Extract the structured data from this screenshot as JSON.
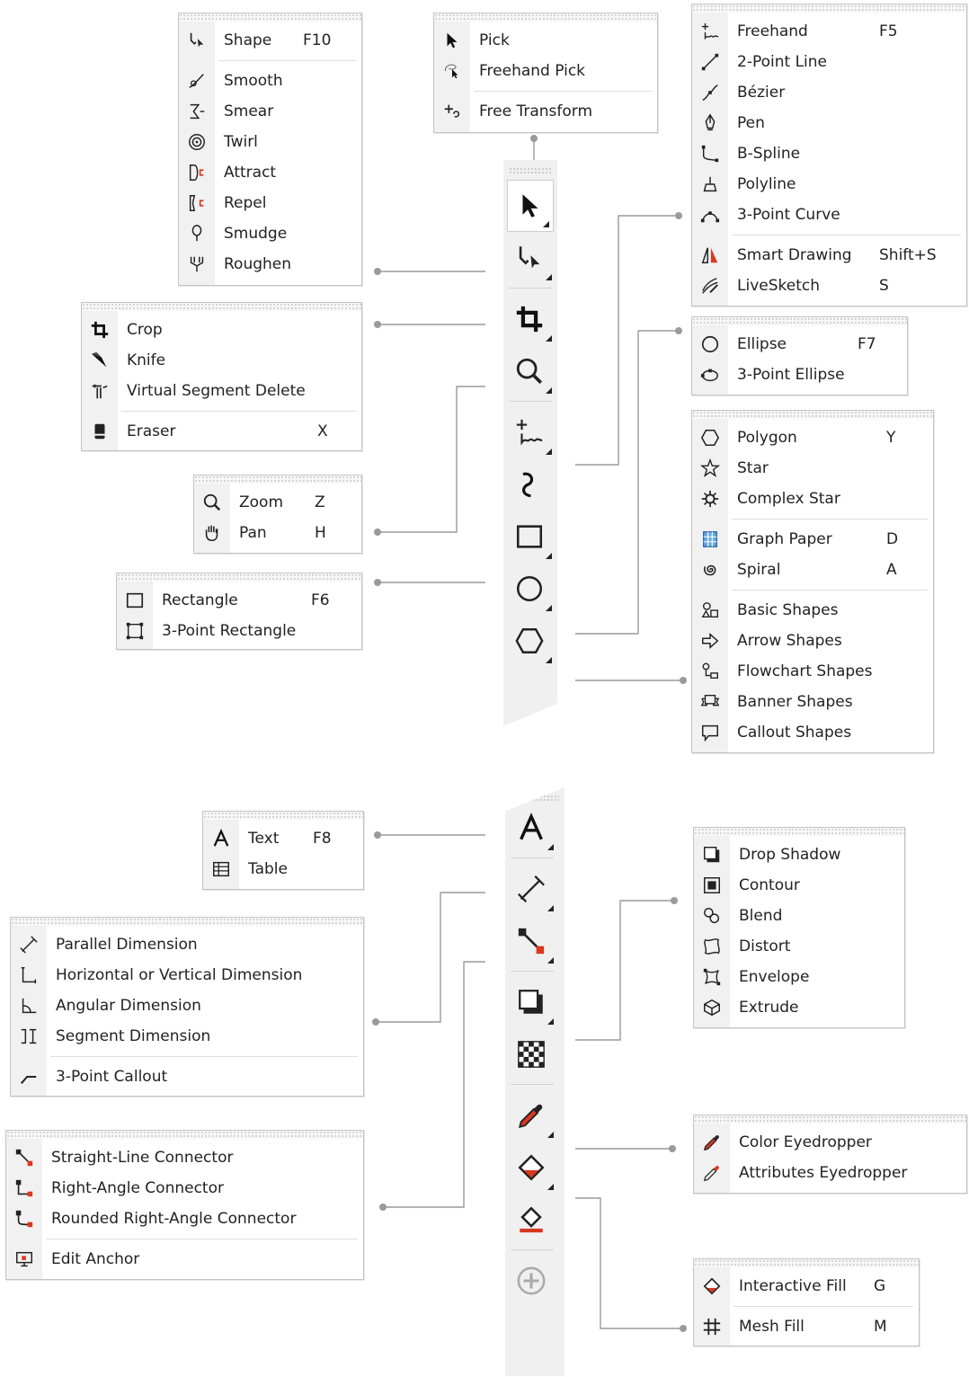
{
  "colors": {
    "accent": "#d9381e",
    "line": "#9a9a9a",
    "menu_border": "#c4c4c4"
  },
  "flyouts": {
    "shape": [
      {
        "label": "Shape",
        "shortcut": "F10",
        "icon": "shape-tool-icon"
      },
      {
        "sep": true
      },
      {
        "label": "Smooth",
        "icon": "smooth-icon"
      },
      {
        "label": "Smear",
        "icon": "smear-icon"
      },
      {
        "label": "Twirl",
        "icon": "twirl-icon"
      },
      {
        "label": "Attract",
        "icon": "attract-icon"
      },
      {
        "label": "Repel",
        "icon": "repel-icon"
      },
      {
        "label": "Smudge",
        "icon": "smudge-icon"
      },
      {
        "label": "Roughen",
        "icon": "roughen-icon"
      }
    ],
    "pick": [
      {
        "label": "Pick",
        "icon": "pick-arrow-icon"
      },
      {
        "label": "Freehand Pick",
        "icon": "freehand-pick-icon"
      },
      {
        "sep": true
      },
      {
        "label": "Free Transform",
        "icon": "free-transform-icon"
      }
    ],
    "curve": [
      {
        "label": "Freehand",
        "shortcut": "F5",
        "icon": "freehand-icon"
      },
      {
        "label": "2-Point Line",
        "icon": "two-point-line-icon"
      },
      {
        "label": "Bézier",
        "icon": "bezier-icon"
      },
      {
        "label": "Pen",
        "icon": "pen-icon"
      },
      {
        "label": "B-Spline",
        "icon": "b-spline-icon"
      },
      {
        "label": "Polyline",
        "icon": "polyline-icon"
      },
      {
        "label": "3-Point Curve",
        "icon": "three-point-curve-icon"
      },
      {
        "sep": true
      },
      {
        "label": "Smart Drawing",
        "shortcut": "Shift+S",
        "icon": "smart-drawing-icon"
      },
      {
        "label": "LiveSketch",
        "shortcut": "S",
        "icon": "livesketch-icon"
      }
    ],
    "crop": [
      {
        "label": "Crop",
        "icon": "crop-icon"
      },
      {
        "label": "Knife",
        "icon": "knife-icon"
      },
      {
        "label": "Virtual Segment Delete",
        "icon": "virtual-segment-delete-icon"
      },
      {
        "sep": true
      },
      {
        "label": "Eraser",
        "shortcut": "X",
        "icon": "eraser-icon"
      }
    ],
    "ellipse": [
      {
        "label": "Ellipse",
        "shortcut": "F7",
        "icon": "ellipse-icon"
      },
      {
        "label": "3-Point Ellipse",
        "icon": "three-point-ellipse-icon"
      }
    ],
    "zoom": [
      {
        "label": "Zoom",
        "shortcut": "Z",
        "icon": "zoom-icon"
      },
      {
        "label": "Pan",
        "shortcut": "H",
        "icon": "pan-hand-icon"
      }
    ],
    "rectangle": [
      {
        "label": "Rectangle",
        "shortcut": "F6",
        "icon": "rectangle-icon"
      },
      {
        "label": "3-Point Rectangle",
        "icon": "three-point-rectangle-icon"
      }
    ],
    "polygon": [
      {
        "label": "Polygon",
        "shortcut": "Y",
        "icon": "polygon-icon"
      },
      {
        "label": "Star",
        "icon": "star-icon"
      },
      {
        "label": "Complex Star",
        "icon": "complex-star-icon"
      },
      {
        "sep": true
      },
      {
        "label": "Graph Paper",
        "shortcut": "D",
        "icon": "graph-paper-icon"
      },
      {
        "label": "Spiral",
        "shortcut": "A",
        "icon": "spiral-icon"
      },
      {
        "sep": true
      },
      {
        "label": "Basic Shapes",
        "icon": "basic-shapes-icon"
      },
      {
        "label": "Arrow Shapes",
        "icon": "arrow-shapes-icon"
      },
      {
        "label": "Flowchart Shapes",
        "icon": "flowchart-shapes-icon"
      },
      {
        "label": "Banner Shapes",
        "icon": "banner-shapes-icon"
      },
      {
        "label": "Callout Shapes",
        "icon": "callout-shapes-icon"
      }
    ],
    "text": [
      {
        "label": "Text",
        "shortcut": "F8",
        "icon": "text-icon"
      },
      {
        "label": "Table",
        "icon": "table-icon"
      }
    ],
    "effects": [
      {
        "label": "Drop Shadow",
        "icon": "drop-shadow-icon"
      },
      {
        "label": "Contour",
        "icon": "contour-icon"
      },
      {
        "label": "Blend",
        "icon": "blend-icon"
      },
      {
        "label": "Distort",
        "icon": "distort-icon"
      },
      {
        "label": "Envelope",
        "icon": "envelope-icon"
      },
      {
        "label": "Extrude",
        "icon": "extrude-icon"
      }
    ],
    "dimension": [
      {
        "label": "Parallel Dimension",
        "icon": "parallel-dimension-icon"
      },
      {
        "label": "Horizontal or Vertical Dimension",
        "icon": "horizontal-vertical-dimension-icon"
      },
      {
        "label": "Angular Dimension",
        "icon": "angular-dimension-icon"
      },
      {
        "label": "Segment Dimension",
        "icon": "segment-dimension-icon"
      },
      {
        "sep": true
      },
      {
        "label": "3-Point Callout",
        "icon": "three-point-callout-icon"
      }
    ],
    "eyedropper": [
      {
        "label": "Color Eyedropper",
        "icon": "color-eyedropper-icon"
      },
      {
        "label": "Attributes Eyedropper",
        "icon": "attributes-eyedropper-icon"
      }
    ],
    "connector": [
      {
        "label": "Straight-Line Connector",
        "icon": "straight-connector-icon"
      },
      {
        "label": "Right-Angle Connector",
        "icon": "right-angle-connector-icon"
      },
      {
        "label": "Rounded Right-Angle Connector",
        "icon": "rounded-connector-icon"
      },
      {
        "sep": true
      },
      {
        "label": "Edit Anchor",
        "icon": "edit-anchor-icon"
      }
    ],
    "fill": [
      {
        "label": "Interactive Fill",
        "shortcut": "G",
        "icon": "interactive-fill-icon"
      },
      {
        "sep": true
      },
      {
        "label": "Mesh Fill",
        "shortcut": "M",
        "icon": "mesh-fill-icon"
      }
    ]
  },
  "toolbox_top": [
    {
      "name": "pick-tool",
      "icon": "pick-arrow-icon",
      "flyout": true,
      "active": true
    },
    {
      "name": "shape-tool",
      "icon": "shape-tool-icon",
      "flyout": true
    },
    {
      "sep": true
    },
    {
      "name": "crop-tool",
      "icon": "crop-icon",
      "flyout": true
    },
    {
      "name": "zoom-tool",
      "icon": "zoom-icon",
      "flyout": true
    },
    {
      "sep": true
    },
    {
      "name": "freehand-tool",
      "icon": "freehand-icon",
      "flyout": true
    },
    {
      "name": "artistic-media-tool",
      "icon": "artistic-media-icon",
      "flyout": false
    },
    {
      "name": "rectangle-tool",
      "icon": "rectangle-icon",
      "flyout": true
    },
    {
      "name": "ellipse-tool",
      "icon": "ellipse-icon",
      "flyout": true
    },
    {
      "name": "polygon-tool",
      "icon": "polygon-icon",
      "flyout": true
    }
  ],
  "toolbox_bottom": [
    {
      "name": "text-tool",
      "icon": "text-icon",
      "flyout": true
    },
    {
      "sep": true
    },
    {
      "name": "dimension-tool",
      "icon": "parallel-dimension-icon",
      "flyout": true
    },
    {
      "name": "connector-tool",
      "icon": "straight-connector-icon",
      "flyout": true
    },
    {
      "sep": true
    },
    {
      "name": "drop-shadow-tool",
      "icon": "drop-shadow-icon",
      "flyout": true
    },
    {
      "name": "transparency-tool",
      "icon": "transparency-icon",
      "flyout": false
    },
    {
      "sep": true
    },
    {
      "name": "eyedropper-tool",
      "icon": "color-eyedropper-icon",
      "flyout": true
    },
    {
      "name": "interactive-fill-tool",
      "icon": "interactive-fill-icon",
      "flyout": true
    },
    {
      "name": "smart-fill-tool",
      "icon": "smart-fill-icon",
      "flyout": false
    },
    {
      "sep": true
    },
    {
      "name": "add-tool-button",
      "icon": "plus-circle-icon",
      "flyout": false
    }
  ]
}
